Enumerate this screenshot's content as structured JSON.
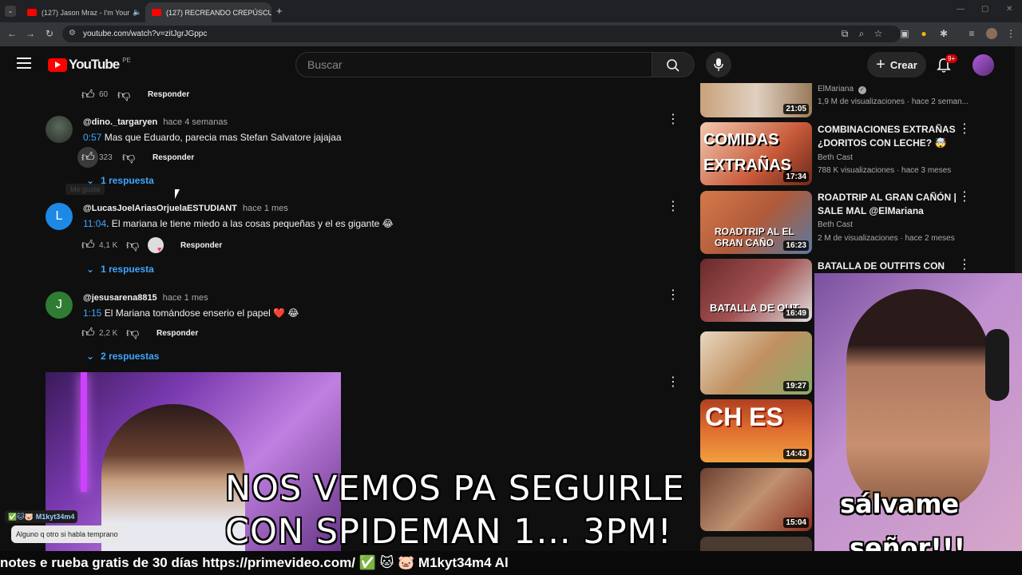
{
  "browser": {
    "tabs": [
      {
        "label": "(127) Jason Mraz - I'm Your",
        "active": false
      },
      {
        "label": "(127) RECREANDO CREPÚSCULO",
        "active": true
      }
    ],
    "url": "youtube.com/watch?v=zitJgrJGppc"
  },
  "header": {
    "logo": "YouTube",
    "country": "PE",
    "search_placeholder": "Buscar",
    "create_label": "Crear",
    "notif_count": "9+"
  },
  "comments": [
    {
      "likes": "60",
      "reply_label": "Responder"
    },
    {
      "author": "@dino._targaryen",
      "ago": "hace 4 semanas",
      "ts": "0:57",
      "text": " Mas que Eduardo, parecia mas Stefan Salvatore jajajaa",
      "likes": "323",
      "reply_label": "Responder",
      "replies": "1 respuesta",
      "tooltip": "Me gusta"
    },
    {
      "author": "@LucasJoelAriasOrjuelaESTUDIANT",
      "ago": "hace 1 mes",
      "avatar_letter": "L",
      "ts": "11:04",
      "text": ". El mariana le tiene miedo a las cosas pequeñas y el es gigante 😂",
      "likes": "4,1 K",
      "reply_label": "Responder",
      "replies": "1 respuesta"
    },
    {
      "author": "@jesusarena8815",
      "ago": "hace 1 mes",
      "avatar_letter": "J",
      "ts": "1:15",
      "text": " El Mariana tomándose enserio el papel ❤️ 😂",
      "likes": "2,2 K",
      "reply_label": "Responder",
      "replies": "2 respuestas"
    }
  ],
  "videos": [
    {
      "title": "",
      "channel": "ElMariana",
      "stats": "1,9 M de visualizaciones · hace 2 seman...",
      "duration": "21:05"
    },
    {
      "title": "COMBINACIONES EXTRAÑAS ¿DORITOS CON LECHE? 🤯",
      "channel": "Beth Cast",
      "stats": "788 K visualizaciones · hace 3 meses",
      "duration": "17:34",
      "thumb_text": "COMIDAS EXTRAÑAS"
    },
    {
      "title": "ROADTRIP AL GRAN CAÑÓN | SALE MAL @ElMariana",
      "channel": "Beth Cast",
      "stats": "2 M de visualizaciones · hace 2 meses",
      "duration": "16:23",
      "thumb_text": "ROADTRIP AL EL GRAN CAÑO"
    },
    {
      "title": "BATALLA DE OUTFITS CON",
      "duration": "16:49",
      "thumb_text": "BATALLA DE OUT"
    },
    {
      "duration": "19:27"
    },
    {
      "duration": "14:43",
      "thumb_text": "CH ES"
    },
    {
      "duration": "15:04"
    }
  ],
  "overlay": {
    "line1": "NOS VEMOS PA SEGUIRLE",
    "line2": "CON SPIDEMAN 1... 3PM!",
    "caption_line1": "sálvame",
    "caption_line2": "señor!!!",
    "ticker": "notes e          rueba gratis de 30 días https://primevideo.com/ ✅ 🐱 🐷 M1kyt34m4 Al",
    "chat_user": "M1kyt34m4",
    "chat_message": "Alguno q otro si habla temprano"
  },
  "colors": {
    "yt_red": "#ff0000",
    "link_blue": "#3ea6ff",
    "bg": "#0f0f0f"
  }
}
